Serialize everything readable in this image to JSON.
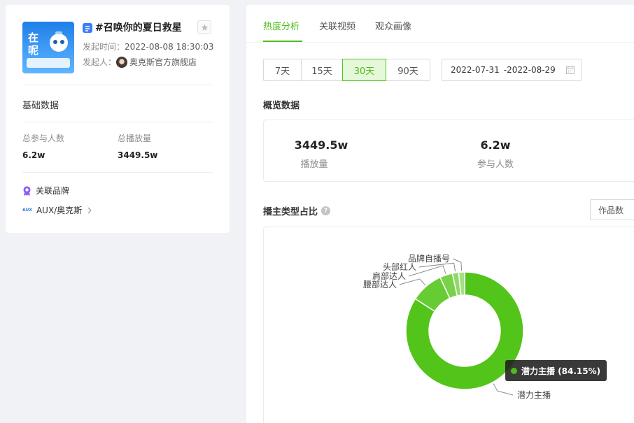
{
  "topic": {
    "title": "#召唤你的夏日救星",
    "publish_time_label": "发起时间：",
    "publish_time": "2022-08-08 18:30:03",
    "initiator_label": "发起人：",
    "initiator": "奥克斯官方旗舰店",
    "thumb_text": "在呢",
    "icons": {
      "topic": "topic-hash-icon",
      "star": "star-icon"
    }
  },
  "basic": {
    "title": "基础数据",
    "participants_label": "总参与人数",
    "participants": "6.2w",
    "plays_label": "总播放量",
    "plays": "3449.5w"
  },
  "brand": {
    "title": "关联品牌",
    "logo_text": "AUX",
    "name": "AUX/奥克斯",
    "icon": "brand-badge-icon"
  },
  "tabs": [
    {
      "label": "热度分析",
      "active": true
    },
    {
      "label": "关联视频",
      "active": false
    },
    {
      "label": "观众画像",
      "active": false
    }
  ],
  "ranges": [
    {
      "label": "7天",
      "active": false
    },
    {
      "label": "15天",
      "active": false
    },
    {
      "label": "30天",
      "active": true
    },
    {
      "label": "90天",
      "active": false
    }
  ],
  "date_range": {
    "start": "2022-07-31",
    "end": "-2022-08-29"
  },
  "overview": {
    "title": "概览数据",
    "plays": "3449.5w",
    "plays_label": "播放量",
    "participants": "6.2w",
    "participants_label": "参与人数"
  },
  "chart_section": {
    "title": "播主类型占比",
    "metric_select": "作品数"
  },
  "chart_data": {
    "type": "pie",
    "donut": true,
    "categories": [
      "潜力主播",
      "腰部达人",
      "肩部达人",
      "头部红人",
      "品牌自播号"
    ],
    "values": [
      84.15,
      9.0,
      3.5,
      1.7,
      1.65
    ],
    "colors": [
      "#52c41a",
      "#66cc33",
      "#7ad14a",
      "#8fd966",
      "#a6e085"
    ],
    "tooltip": "潜力主播 (84.15%)"
  }
}
